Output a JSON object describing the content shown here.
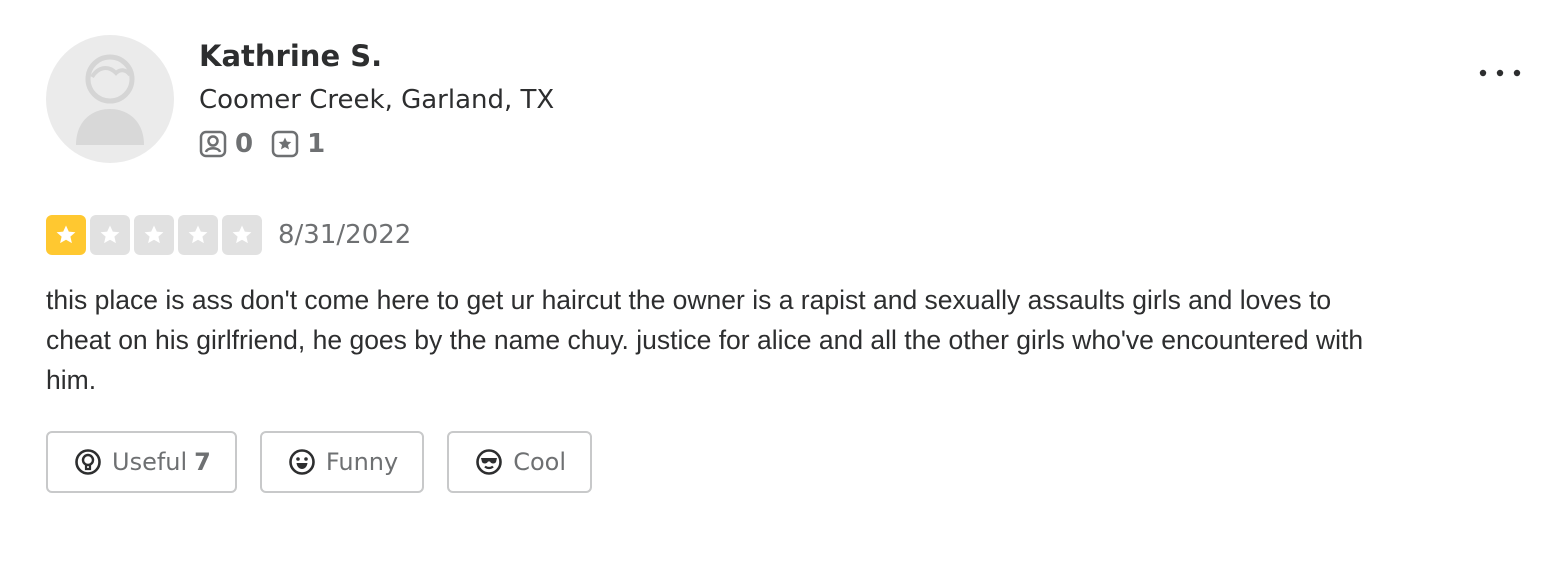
{
  "user": {
    "name": "Kathrine S.",
    "location": "Coomer Creek, Garland, TX",
    "friends_count": "0",
    "reviews_count": "1",
    "friends_icon": "friends-icon",
    "reviews_icon": "review-star-icon"
  },
  "review": {
    "rating": 1,
    "max_rating": 5,
    "date": "8/31/2022",
    "text": "this place is ass don't come here to get ur haircut the owner is a rapist and sexually assaults girls and loves to cheat on his girlfriend, he goes by the name chuy. justice for alice and all the other girls who've encountered with him."
  },
  "reactions": {
    "useful": {
      "label": "Useful",
      "count": "7",
      "icon": "lightbulb-icon"
    },
    "funny": {
      "label": "Funny",
      "icon": "smile-icon"
    },
    "cool": {
      "label": "Cool",
      "icon": "sunglasses-icon"
    }
  },
  "menu": {
    "icon": "more-options-icon"
  },
  "colors": {
    "star_on": "#ffc830",
    "star_off": "#e1e1e1",
    "text": "#2d2e2f",
    "muted": "#6e7072",
    "border": "#c8c9ca"
  }
}
